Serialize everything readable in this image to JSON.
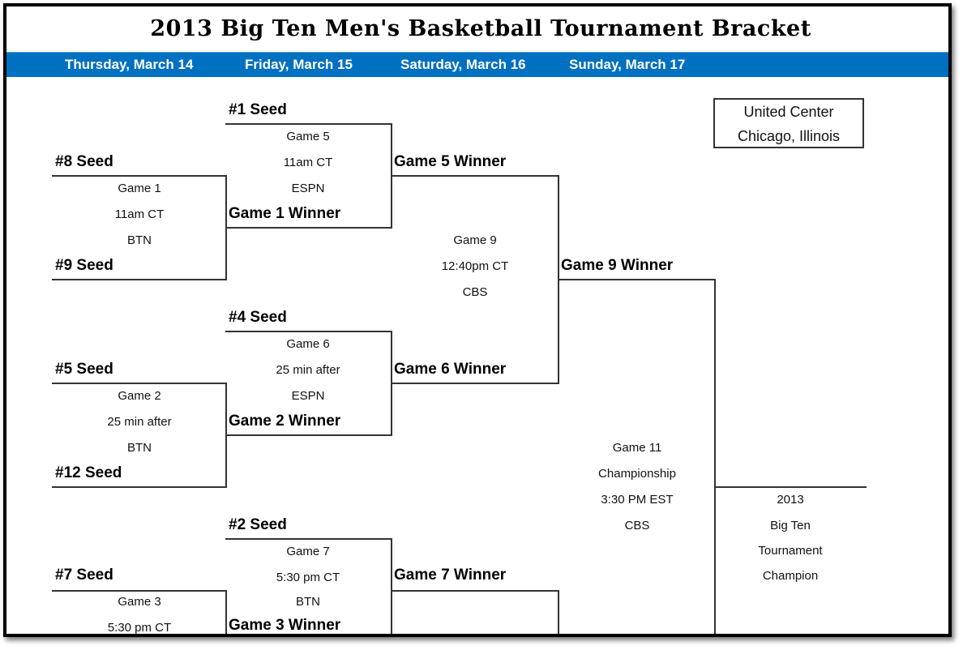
{
  "title": "2013 Big Ten Men's Basketball Tournament Bracket",
  "colors": {
    "band": "#0070c0",
    "band_text": "#ffffff",
    "lines": "#333333"
  },
  "days": [
    "Thursday, March 14",
    "Friday, March 15",
    "Saturday, March 16",
    "Sunday, March 17"
  ],
  "venue": {
    "line1": "United Center",
    "line2": "Chicago, Illinois"
  },
  "round1": [
    {
      "top": "#8 Seed",
      "bottom": "#9 Seed",
      "game": "Game 1",
      "time": "11am CT",
      "network": "BTN"
    },
    {
      "top": "#5 Seed",
      "bottom": "#12 Seed",
      "game": "Game 2",
      "time": "25 min after",
      "network": "BTN"
    },
    {
      "top": "#7 Seed",
      "bottom": "",
      "game": "Game 3",
      "time": "5:30 pm CT",
      "network": ""
    }
  ],
  "round2": [
    {
      "top": "#1 Seed",
      "bottom": "Game 1 Winner",
      "game": "Game 5",
      "time": "11am CT",
      "network": "ESPN"
    },
    {
      "top": "#4 Seed",
      "bottom": "Game 2 Winner",
      "game": "Game 6",
      "time": "25 min after",
      "network": "ESPN"
    },
    {
      "top": "#2 Seed",
      "bottom": "Game 3 Winner",
      "game": "Game 7",
      "time": "5:30 pm CT",
      "network": "BTN"
    }
  ],
  "round3": [
    {
      "top": "Game 5 Winner",
      "bottom": "Game 6 Winner",
      "game": "Game 9",
      "time": "12:40pm CT",
      "network": "CBS"
    },
    {
      "top": "Game 7 Winner"
    }
  ],
  "final": {
    "top": "Game 9 Winner",
    "game": "Game 11",
    "name": "Championship",
    "time": "3:30 PM EST",
    "network": "CBS"
  },
  "champion": [
    "2013",
    "Big Ten",
    "Tournament",
    "Champion"
  ]
}
